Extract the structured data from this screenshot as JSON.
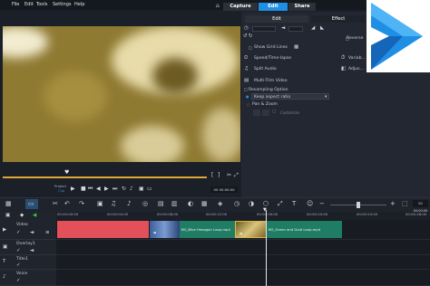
{
  "menu": {
    "file": "File",
    "edit": "Edit",
    "tools": "Tools",
    "settings": "Settings",
    "help": "Help"
  },
  "modes": {
    "capture": "Capture",
    "edit": "Edit",
    "share": "Share"
  },
  "panel": {
    "tab_edit": "Edit",
    "tab_effect": "Effect",
    "show_grid_lines": "Show Grid Lines",
    "reverse": "Reverse",
    "speed": "Speed/Time-lapse",
    "variable": "Variab...",
    "split_audio": "Split Audio",
    "adjust": "Adjus...",
    "multi_trim": "Multi-Trim Video",
    "resampling_option": "Resampling Option",
    "keep_aspect": "Keep aspect ratio",
    "pan_zoom": "Pan & Zoom",
    "customize": "Customize"
  },
  "player": {
    "project_label": "Project",
    "clip_label": "Clip",
    "timecode": "00 00:00:00"
  },
  "timeline": {
    "ruler": [
      "00:00:00:00",
      "00:00:04:00",
      "00:00:08:00",
      "00:00:12:00",
      "00:00:16:00",
      "00:00:20:00",
      "00:00:24:00",
      "00:00:28:00"
    ],
    "tracks": {
      "video": "Video",
      "overlay": "Overlay1",
      "title": "Title1",
      "voice": "Voice"
    },
    "clips": {
      "blue": "BG_Blue Hexagon Loop.mp4",
      "green": "BG_Green and Gold Loop.mp4"
    }
  },
  "colors": {
    "accent": "#1f8fe6",
    "red_clip": "#e2505a",
    "green_clip": "#1f7d63",
    "viewer": "#8f7a32"
  }
}
